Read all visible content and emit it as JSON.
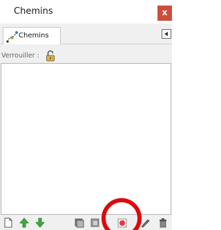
{
  "panel": {
    "title": "Chemins",
    "close_label": "x"
  },
  "tabs": [
    {
      "label": "Chemins",
      "icon": "path-icon"
    }
  ],
  "lock": {
    "label": "Verrouiller :",
    "icon": "padlock-icon"
  },
  "toolbar": {
    "buttons": [
      {
        "name": "new-document-icon"
      },
      {
        "name": "arrow-up-icon"
      },
      {
        "name": "arrow-down-icon"
      },
      {
        "name": "layers-icon"
      },
      {
        "name": "layers-dark-icon"
      },
      {
        "name": "node-point-icon"
      },
      {
        "name": "pen-icon"
      },
      {
        "name": "trash-icon"
      }
    ]
  },
  "colors": {
    "close_button": "#c94f3c",
    "highlight_circle": "#e0070b",
    "arrow_green": "#3faa3f"
  }
}
